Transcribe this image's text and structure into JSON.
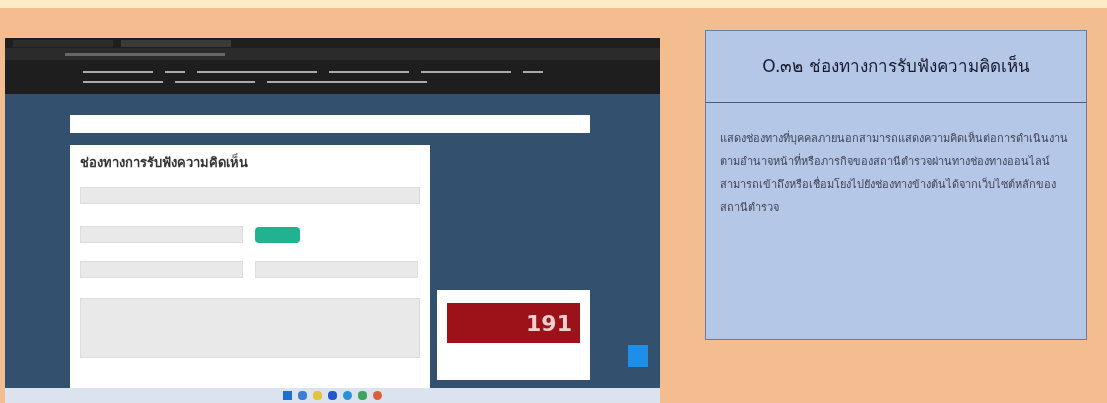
{
  "screenshot": {
    "form": {
      "title": "ช่องทางการรับฟังความคิดเห็น"
    },
    "popup_banner": {
      "number": "191"
    }
  },
  "info_panel": {
    "title": "O.๓๒ ช่องทางการรับฟังความคิดเห็น",
    "description": "แสดงช่องทางที่บุคคลภายนอกสามารถแสดงความคิดเห็นต่อการดำเนินงานตามอำนาจหน้าที่หรือภารกิจของสถานีตำรวจผ่านทางช่องทางออนไลน์ สามารถเข้าถึงหรือเชื่อมโยงไปยังช่องทางข้างต้นได้จากเว็บไซต์หลักของสถานีตำรวจ"
  }
}
